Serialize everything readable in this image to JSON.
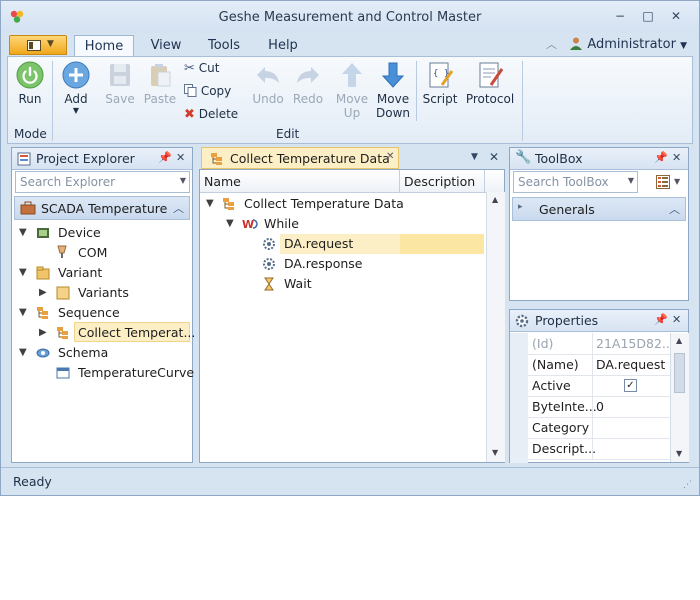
{
  "window": {
    "title": "Geshe Measurement and Control Master",
    "controls": [
      "−",
      "□",
      "✕"
    ]
  },
  "ribbon": {
    "tabs": [
      "Home",
      "View",
      "Tools",
      "Help"
    ],
    "user": "Administrator",
    "groups": {
      "mode": {
        "label": "Mode",
        "run": "Run"
      },
      "edit": {
        "label": "Edit",
        "add": "Add",
        "save": "Save",
        "paste": "Paste",
        "cut": "Cut",
        "copy": "Copy",
        "delete": "Delete",
        "undo": "Undo",
        "redo": "Redo",
        "move_up": "Move Up",
        "move_down": "Move Down",
        "script": "Script",
        "protocol": "Protocol"
      }
    }
  },
  "project_explorer": {
    "title": "Project Explorer",
    "search_placeholder": "Search Explorer",
    "header": "SCADA Temperature",
    "items": [
      {
        "label": "Device"
      },
      {
        "label": "COM"
      },
      {
        "label": "Variant"
      },
      {
        "label": "Variants"
      },
      {
        "label": "Sequence"
      },
      {
        "label": "Collect Temperat..."
      },
      {
        "label": "Schema"
      },
      {
        "label": "TemperatureCurve"
      }
    ]
  },
  "editor": {
    "tab_title": "Collect Temperature Data",
    "columns": [
      "Name",
      "Description"
    ],
    "rows": [
      {
        "label": "Collect Temperature Data"
      },
      {
        "label": "While"
      },
      {
        "label": "DA.request"
      },
      {
        "label": "DA.response"
      },
      {
        "label": "Wait"
      }
    ]
  },
  "toolbox": {
    "title": "ToolBox",
    "search_placeholder": "Search ToolBox",
    "section": "Generals"
  },
  "properties": {
    "title": "Properties",
    "rows": [
      {
        "name": "(Id)",
        "value": "21A15D82..."
      },
      {
        "name": "(Name)",
        "value": "DA.request"
      },
      {
        "name": "Active",
        "value": "✓"
      },
      {
        "name": "ByteInte...",
        "value": "0"
      },
      {
        "name": "Category",
        "value": ""
      },
      {
        "name": "Descript...",
        "value": ""
      }
    ]
  },
  "status": {
    "text": "Ready"
  },
  "colors": {
    "selection": "#fcefc5",
    "accent": "#f0a71a",
    "chrome": "#d6e3f1"
  }
}
